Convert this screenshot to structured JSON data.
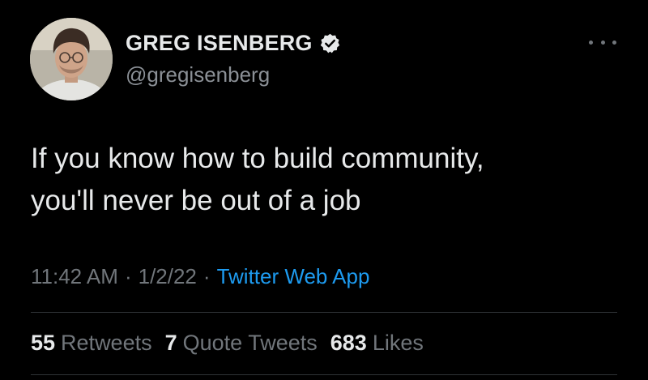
{
  "author": {
    "display_name": "GREG ISENBERG",
    "handle": "@gregisenberg",
    "verified_icon": "verified-badge-icon",
    "avatar": "profile-photo"
  },
  "menu": {
    "icon": "more-horizontal-icon"
  },
  "tweet": {
    "text": "If you know how to build community,\nyou'll never be out of a job",
    "time": "11:42 AM",
    "date": "1/2/22",
    "separator": "·",
    "source": "Twitter Web App"
  },
  "stats": {
    "retweets": {
      "count": "55",
      "label": "Retweets"
    },
    "quote_tweets": {
      "count": "7",
      "label": "Quote Tweets"
    },
    "likes": {
      "count": "683",
      "label": "Likes"
    }
  },
  "colors": {
    "background": "#000000",
    "text_primary": "#e7e9ea",
    "text_secondary": "#71767b",
    "link": "#1d9bf0",
    "divider": "#2f3336"
  }
}
